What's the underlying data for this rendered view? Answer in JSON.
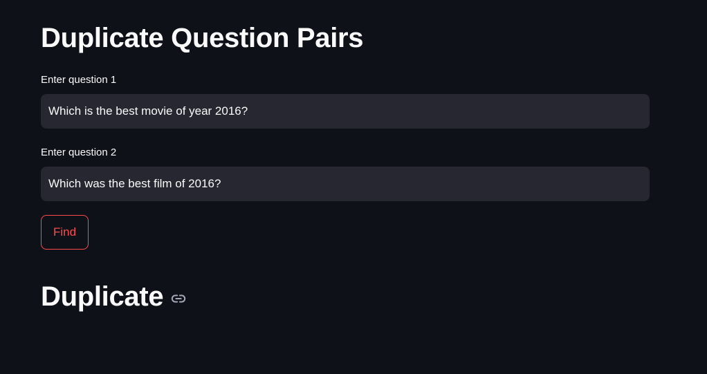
{
  "page": {
    "title": "Duplicate Question Pairs"
  },
  "form": {
    "question1": {
      "label": "Enter question 1",
      "value": "Which is the best movie of year 2016?"
    },
    "question2": {
      "label": "Enter question 2",
      "value": "Which was the best film of 2016?"
    },
    "find_button_label": "Find"
  },
  "result": {
    "text": "Duplicate",
    "anchor_icon": "link-icon"
  },
  "colors": {
    "background": "#0e1117",
    "input_background": "#262730",
    "accent": "#ff4b4b",
    "text": "#fafafa"
  }
}
